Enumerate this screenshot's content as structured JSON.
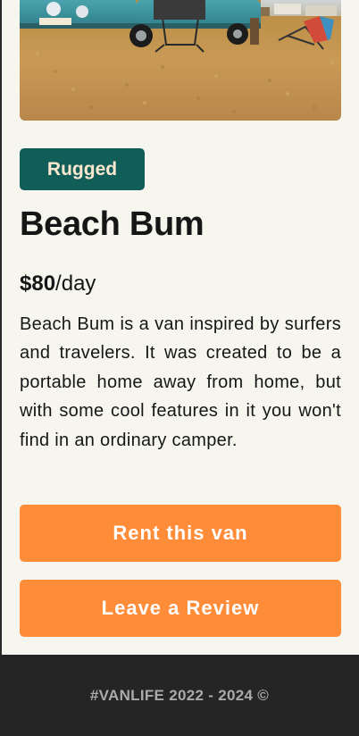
{
  "van": {
    "type_badge": "Rugged",
    "name": "Beach Bum",
    "price_amount": "$80",
    "price_unit": "/day",
    "description": "Beach Bum is a van inspired by surfers and travelers. It was created to be a portable home away from home, but with some cool features in it you won't find in an ordinary camper."
  },
  "actions": {
    "rent_label": "Rent this van",
    "review_label": "Leave a Review"
  },
  "footer": {
    "text": "#VANLIFE 2022 - 2024 ©"
  },
  "colors": {
    "page_background": "#f7f6ee",
    "badge_background": "#115e59",
    "badge_text": "#fde8cf",
    "button_background": "#ff8c38",
    "footer_background": "#252525"
  }
}
